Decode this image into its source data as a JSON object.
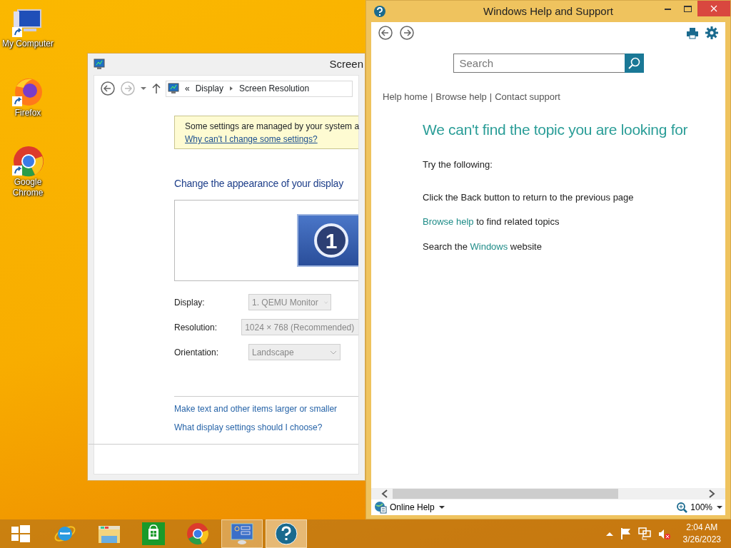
{
  "desktop_icons": [
    {
      "label": "My Computer",
      "kind": "computer"
    },
    {
      "label": "Firefox",
      "kind": "firefox"
    },
    {
      "label": "Google Chrome",
      "kind": "chrome"
    }
  ],
  "screen_resolution": {
    "title": "Screen",
    "breadcrumb": {
      "prefix": "«",
      "items": [
        "Display",
        "Screen Resolution"
      ]
    },
    "info": {
      "text": "Some settings are managed by your system a",
      "link": "Why can't I change some settings?"
    },
    "heading": "Change the appearance of your display",
    "monitor_label": "1",
    "settings": [
      {
        "label": "Display:",
        "value": "1. QEMU Monitor",
        "disabled": true,
        "kind": "dropdown"
      },
      {
        "label": "Resolution:",
        "value": "1024 × 768 (Recommended)",
        "disabled": true,
        "kind": "clipped"
      },
      {
        "label": "Orientation:",
        "value": "Landscape",
        "disabled": true,
        "kind": "dropdown"
      }
    ],
    "links": [
      "Make text and other items larger or smaller",
      "What display settings should I choose?"
    ]
  },
  "help": {
    "title": "Windows Help and Support",
    "search": {
      "placeholder": "Search"
    },
    "nav_links": [
      "Help home",
      "Browse help",
      "Contact support"
    ],
    "nav_separator": "|",
    "heading": "We can't find the topic you are looking for",
    "lines": [
      {
        "parts": [
          {
            "text": "Try the following:",
            "link": false
          }
        ]
      },
      {
        "parts": [
          {
            "text": "Click the Back button to return to the previous page",
            "link": false
          }
        ]
      },
      {
        "parts": [
          {
            "text": "Browse help",
            "link": true
          },
          {
            "text": " to find related topics",
            "link": false
          }
        ]
      },
      {
        "parts": [
          {
            "text": "Search the ",
            "link": false
          },
          {
            "text": "Windows",
            "link": true
          },
          {
            "text": " website",
            "link": false
          }
        ]
      }
    ],
    "status": {
      "online_help": "Online Help",
      "zoom": "100%"
    }
  },
  "taskbar": {
    "apps": [
      {
        "kind": "start",
        "running": false,
        "selected": false
      },
      {
        "kind": "ie",
        "running": false,
        "selected": false
      },
      {
        "kind": "explorer",
        "running": false,
        "selected": false
      },
      {
        "kind": "store",
        "running": false,
        "selected": false
      },
      {
        "kind": "chrome",
        "running": false,
        "selected": false
      },
      {
        "kind": "display",
        "running": true,
        "selected": false
      },
      {
        "kind": "help",
        "running": true,
        "selected": true
      }
    ],
    "clock": {
      "time": "2:04 AM",
      "date": "3/26/2023"
    }
  }
}
